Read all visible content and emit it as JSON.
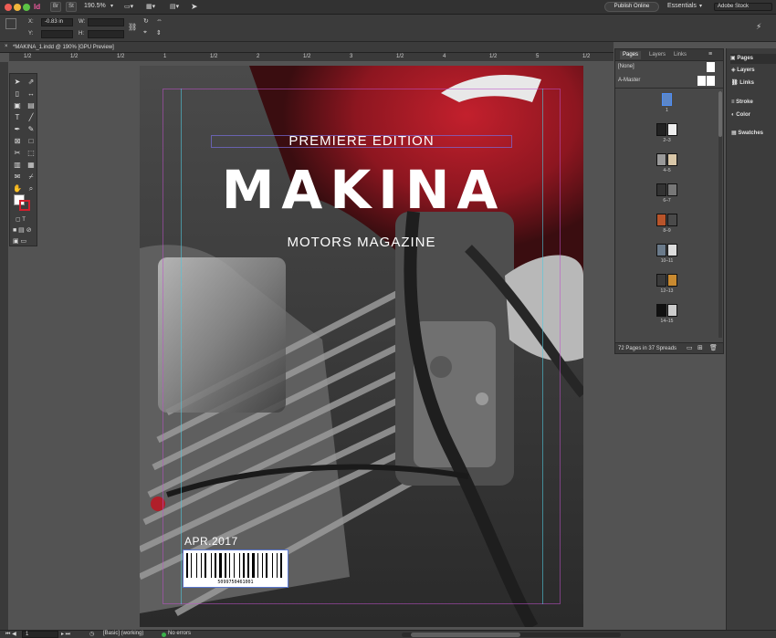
{
  "app": {
    "logo": "Id",
    "zoom": "190.5%",
    "publish_button": "Publish Online",
    "workspace": "Essentials",
    "search_placeholder": "Adobe Stock",
    "bridge_btn": "Br",
    "stock_btn": "St"
  },
  "control": {
    "x_label": "X:",
    "x_value": "-0.83 in",
    "y_label": "Y:",
    "y_value": "",
    "w_label": "W:",
    "w_value": "",
    "h_label": "H:",
    "h_value": ""
  },
  "document": {
    "tab_title": "*MAKINA_1.indd @ 190% [GPU Preview]"
  },
  "ruler": {
    "h_ticks": [
      "1/2",
      "1/2",
      "1/2",
      "1",
      "1/2",
      "2",
      "1/2",
      "3",
      "1/2",
      "4",
      "1/2",
      "5",
      "1/2"
    ]
  },
  "cover": {
    "premiere": "PREMIERE EDITION",
    "title": "MAKINA",
    "subtitle": "MOTORS MAGAZINE",
    "date": "APR.2017",
    "barcode_number": "5099750461001"
  },
  "pages_panel": {
    "tabs": [
      "Pages",
      "Layers",
      "Links"
    ],
    "none_label": "[None]",
    "master_label": "A-Master",
    "spread_labels": [
      "1",
      "2–3",
      "4–5",
      "6–7",
      "8–9",
      "10–11",
      "12–13",
      "14–15"
    ],
    "footer": "72 Pages in 37 Spreads"
  },
  "dock": {
    "items": [
      "Pages",
      "Layers",
      "Links",
      "Stroke",
      "Color",
      "Swatches"
    ]
  },
  "status": {
    "page_number": "1",
    "preflight_profile": "[Basic] (working)",
    "errors": "No errors"
  }
}
